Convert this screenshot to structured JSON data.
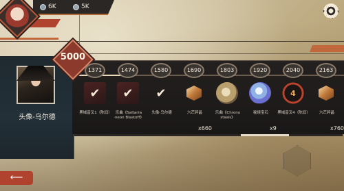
{
  "top_bar": {
    "resource_1_value": "6K",
    "resource_2_value": "5K"
  },
  "featured": {
    "threshold": "5000",
    "title": "头像-乌尔德"
  },
  "rewards": [
    {
      "level": "1371",
      "name": "黑域音叉1（陈旧）",
      "icon": "check-icon",
      "claimed": true
    },
    {
      "level": "1474",
      "name": "乐曲《Saltarra ·neon Blastoff》",
      "icon": "check-icon",
      "claimed": true
    },
    {
      "level": "1580",
      "name": "头像-乌尔德",
      "icon": "check-icon",
      "claimed": true
    },
    {
      "level": "1690",
      "name": "六芒碎晶",
      "icon": "hexa-crystal-icon",
      "claimed": false
    },
    {
      "level": "1803",
      "name": "乐曲《Chrono stasis》",
      "icon": "music-disk-icon",
      "claimed": false
    },
    {
      "level": "1920",
      "name": "秘境宝石",
      "icon": "gem-crystal-icon",
      "claimed": false
    },
    {
      "level": "2040",
      "name": "黑域音叉4（陈旧）",
      "icon": "tuning-token-icon",
      "token_label": "4",
      "claimed": false
    },
    {
      "level": "2163",
      "name": "六芒碎晶",
      "icon": "hexa-crystal-icon",
      "claimed": false
    }
  ],
  "quantities": {
    "hexa_1": "x660",
    "gem": "x9",
    "hexa_2": "x760"
  },
  "progress_fraction": 0.22,
  "colors": {
    "accent": "#b0432e",
    "panel": "#1f1c1b",
    "parchment": "#cfc2a6"
  },
  "back_button": {
    "label": "⟵"
  }
}
